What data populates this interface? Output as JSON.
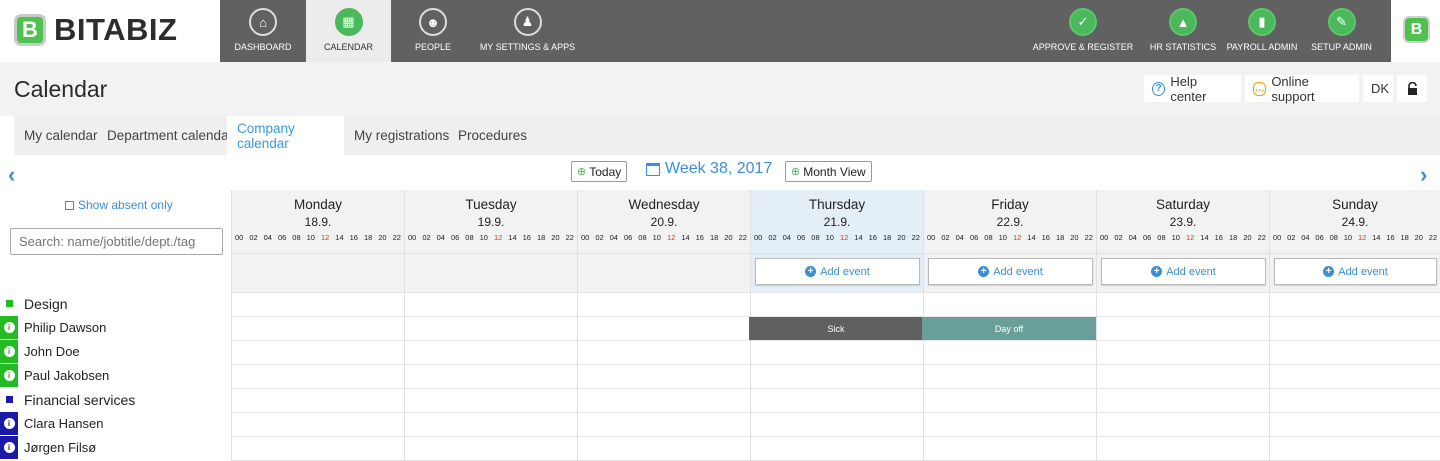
{
  "brand": {
    "name": "BITABIZ",
    "logo_letter": "B"
  },
  "nav": {
    "left": [
      {
        "label": "DASHBOARD",
        "icon": "home-icon"
      },
      {
        "label": "CALENDAR",
        "icon": "calendar-icon"
      },
      {
        "label": "PEOPLE",
        "icon": "people-icon"
      },
      {
        "label": "MY SETTINGS & APPS",
        "icon": "user-icon"
      }
    ],
    "right": [
      {
        "label": "APPROVE & REGISTER",
        "icon": "check-icon"
      },
      {
        "label": "HR STATISTICS",
        "icon": "chart-icon"
      },
      {
        "label": "PAYROLL ADMIN",
        "icon": "payroll-icon"
      },
      {
        "label": "SETUP ADMIN",
        "icon": "wrench-icon"
      }
    ]
  },
  "page": {
    "title": "Calendar"
  },
  "header_buttons": {
    "help": "Help center",
    "support": "Online support",
    "lang": "DK"
  },
  "tabs": [
    "My calendar",
    "Department calendar",
    "Company calendar",
    "My registrations",
    "Procedures"
  ],
  "toolbar": {
    "today": "Today",
    "week": "Week 38, 2017",
    "month_view": "Month View"
  },
  "sidebar": {
    "show_absent": "Show absent only",
    "search_placeholder": "Search: name/jobtitle/dept./tag"
  },
  "days": [
    {
      "name": "Monday",
      "date": "18.9."
    },
    {
      "name": "Tuesday",
      "date": "19.9."
    },
    {
      "name": "Wednesday",
      "date": "20.9."
    },
    {
      "name": "Thursday",
      "date": "21.9."
    },
    {
      "name": "Friday",
      "date": "22.9."
    },
    {
      "name": "Saturday",
      "date": "23.9."
    },
    {
      "name": "Sunday",
      "date": "24.9."
    }
  ],
  "hours": [
    "00",
    "02",
    "04",
    "06",
    "08",
    "10",
    "12",
    "14",
    "16",
    "18",
    "20",
    "22"
  ],
  "add_event_label": "Add event",
  "departments": [
    {
      "name": "Design",
      "color": "#22bb22",
      "people": [
        "Philip Dawson",
        "John Doe",
        "Paul Jakobsen"
      ]
    },
    {
      "name": "Financial services",
      "color": "#1a1aa6",
      "people": [
        "Clara Hansen",
        "Jørgen Filsø"
      ]
    }
  ],
  "events": [
    {
      "label": "Sick",
      "person": "Philip Dawson",
      "day": "Thursday",
      "color": "#606060"
    },
    {
      "label": "Day off",
      "person": "Philip Dawson",
      "day": "Friday",
      "color": "#6a9e98"
    }
  ],
  "colors": {
    "accent": "#3a8fd8",
    "nav_bg": "#616161",
    "green": "#4cb85c"
  }
}
